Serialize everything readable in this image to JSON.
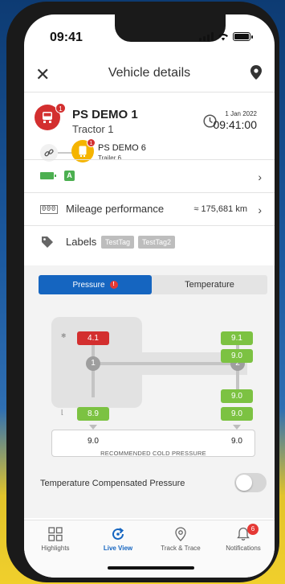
{
  "status_bar": {
    "time": "09:41"
  },
  "header": {
    "title": "Vehicle details",
    "close_icon": "close-icon",
    "location_icon": "location-pin-icon"
  },
  "vehicle": {
    "name": "PS DEMO 1",
    "type": "Tractor 1",
    "alert_count": "1",
    "date": "1 Jan 2022",
    "time": "09:41:00",
    "trailer": {
      "name": "PS DEMO 6",
      "type": "Trailer 6",
      "alert_count": "1"
    }
  },
  "battery_row": {
    "grade": "A",
    "icon": "battery-icon"
  },
  "mileage_row": {
    "label": "Mileage performance",
    "value": "≈ 175,681 km",
    "icon": "odometer-icon"
  },
  "labels_row": {
    "label": "Labels",
    "tags": [
      "TestTag",
      "TestTag2"
    ],
    "icon": "tag-icon"
  },
  "tabs": {
    "pressure": "Pressure",
    "temperature": "Temperature",
    "active": "pressure"
  },
  "axles": {
    "axle1": {
      "label": "1",
      "left": "4.1",
      "right": "8.9"
    },
    "axle2": {
      "label": "2",
      "left_outer": "9.1",
      "left_inner": "9.0",
      "right_inner": "9.0",
      "right_outer": "9.0"
    }
  },
  "recommended": {
    "left": "9.0",
    "right": "9.0",
    "label": "RECOMMENDED COLD PRESSURE"
  },
  "temp_compensated": {
    "label": "Temperature Compensated Pressure",
    "enabled": false
  },
  "colors": {
    "primary": "#1565c0",
    "alert": "#d32f2f",
    "ok": "#7cc242",
    "trailer": "#f5b400"
  },
  "bottom_nav": [
    {
      "label": "Highlights",
      "icon": "grid-icon"
    },
    {
      "label": "Live View",
      "icon": "refresh-icon"
    },
    {
      "label": "Track & Trace",
      "icon": "location-pin-icon"
    },
    {
      "label": "Notifications",
      "icon": "bell-icon",
      "badge": "6"
    }
  ]
}
